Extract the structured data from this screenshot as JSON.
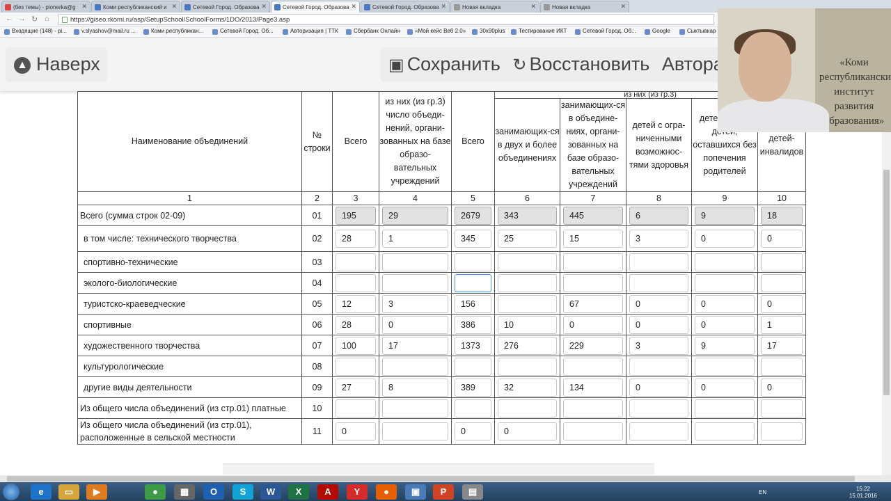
{
  "browser": {
    "tabs": [
      {
        "label": "(без темы) - pionerka@g"
      },
      {
        "label": "Коми республиканский и"
      },
      {
        "label": "Сетевой Город. Образова"
      },
      {
        "label": "Сетевой Город. Образова"
      },
      {
        "label": "Сетевой Город. Образова"
      },
      {
        "label": "Новая вкладка"
      },
      {
        "label": "Новая вкладка"
      }
    ],
    "url": "https://giseo.rkomi.ru/asp/SetupSchool/SchoolForms/1DO/2013/Page3.asp",
    "bookmarks": [
      "Входящие (148) - pi...",
      "v.slyashov@mail.ru ...",
      "Коми республикан...",
      "Сетевой Город. Об...",
      "Авторизация | ТТК",
      "Сбербанк Онлайн",
      "«Мой кейс Веб 2.0»",
      "30x90plus",
      "Тестирование ИКТ",
      "Сетевой Город. Об...",
      "Google",
      "Сыктывкар"
    ]
  },
  "toolbar": {
    "up_label": "Наверх",
    "save_label": "Сохранить",
    "restore_label": "Восстановить",
    "auto_label": "Авторас"
  },
  "webcam": {
    "poster_text": "«Коми республиканский институт развития образования»"
  },
  "table": {
    "top_header_fragment": "из них (из гр.3)",
    "headers": {
      "name": "Наименование объединений",
      "row_no": "№ строки",
      "c3": "Всего",
      "c4": "из них (из гр.3) число объеди-нений, органи-зованных на базе образо-вательных учреждений",
      "c5": "Всего",
      "c6": "занимающих-ся в двух и более объединениях",
      "c7": "занимающих-ся в объедине-ниях, органи-зованных на базе образо-вательных учреждений",
      "c8": "детей с огра-ниченными возможнос-тями здоровья",
      "c9": "детей-сирот, детей, оставшихся без попечения родителей",
      "c10": "детей-инвалидов"
    },
    "col_numbers": [
      "1",
      "2",
      "3",
      "4",
      "5",
      "6",
      "7",
      "8",
      "9",
      "10"
    ],
    "rows": [
      {
        "name": "Всего (сумма строк 02-09)",
        "code": "01",
        "values": [
          "195",
          "29",
          "2679",
          "343",
          "445",
          "6",
          "9",
          "18"
        ]
      },
      {
        "name": "в том числе: технического творчества",
        "code": "02",
        "values": [
          "28",
          "1",
          "345",
          "25",
          "15",
          "3",
          "0",
          "0"
        ]
      },
      {
        "name": "спортивно-технические",
        "code": "03",
        "values": [
          "",
          "",
          "",
          "",
          "",
          "",
          "",
          ""
        ]
      },
      {
        "name": "эколого-биологические",
        "code": "04",
        "values": [
          "",
          "",
          "",
          "",
          "",
          "",
          "",
          ""
        ]
      },
      {
        "name": "туристско-краеведческие",
        "code": "05",
        "values": [
          "12",
          "3",
          "156",
          "",
          "67",
          "0",
          "0",
          "0"
        ]
      },
      {
        "name": "спортивные",
        "code": "06",
        "values": [
          "28",
          "0",
          "386",
          "10",
          "0",
          "0",
          "0",
          "1"
        ]
      },
      {
        "name": "художественного творчества",
        "code": "07",
        "values": [
          "100",
          "17",
          "1373",
          "276",
          "229",
          "3",
          "9",
          "17"
        ]
      },
      {
        "name": "культурологические",
        "code": "08",
        "values": [
          "",
          "",
          "",
          "",
          "",
          "",
          "",
          ""
        ]
      },
      {
        "name": "другие виды деятельности",
        "code": "09",
        "values": [
          "27",
          "8",
          "389",
          "32",
          "134",
          "0",
          "0",
          "0"
        ]
      },
      {
        "name": "Из общего числа объединений (из стр.01) платные",
        "code": "10",
        "values": [
          "",
          "",
          "",
          "",
          "",
          "",
          "",
          ""
        ]
      },
      {
        "name": "Из общего числа объединений (из стр.01), расположенные в сельской местности",
        "code": "11",
        "values": [
          "0",
          "",
          "0",
          "0",
          "",
          "",
          "",
          ""
        ]
      }
    ]
  },
  "tray": {
    "lang": "EN",
    "time": "15:22",
    "date": "15.01.2016"
  },
  "colors": {
    "readonly_fill": "#e2e2e2",
    "focus_border": "#4c8fdc",
    "taskbar": "#2b4d70"
  }
}
